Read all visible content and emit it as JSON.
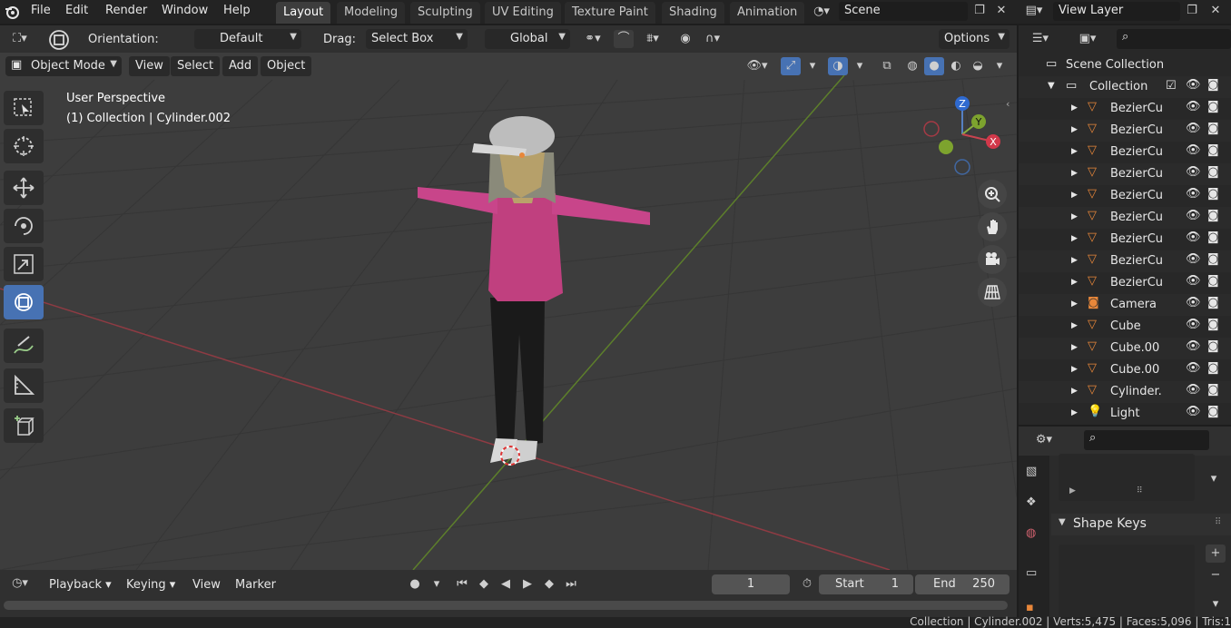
{
  "menu": {
    "items": [
      "File",
      "Edit",
      "Render",
      "Window",
      "Help"
    ]
  },
  "workspaces": {
    "tabs": [
      "Layout",
      "Modeling",
      "Sculpting",
      "UV Editing",
      "Texture Paint",
      "Shading",
      "Animation"
    ],
    "active": "Layout"
  },
  "scene": {
    "name": "Scene"
  },
  "view_layer": {
    "name": "View Layer"
  },
  "tool_header": {
    "orientation_label": "Orientation:",
    "orientation_value": "Default",
    "drag_label": "Drag:",
    "drag_value": "Select Box",
    "transform_orientation": "Global",
    "options_label": "Options"
  },
  "viewport_header": {
    "mode": "Object Mode",
    "menus": [
      "View",
      "Select",
      "Add",
      "Object"
    ]
  },
  "viewport": {
    "perspective_label": "User Perspective",
    "context_label": "(1) Collection | Cylinder.002",
    "gizmo_axes": {
      "z": "Z",
      "y": "Y",
      "x": "X"
    }
  },
  "timeline": {
    "menus": [
      "Playback",
      "Keying",
      "View",
      "Marker"
    ],
    "current_frame": "1",
    "start_label": "Start",
    "start_value": "1",
    "end_label": "End",
    "end_value": "250"
  },
  "outliner": {
    "root": "Scene Collection",
    "collection": "Collection",
    "items": [
      {
        "name": "BezierCu",
        "type": "curve"
      },
      {
        "name": "BezierCu",
        "type": "curve"
      },
      {
        "name": "BezierCu",
        "type": "curve"
      },
      {
        "name": "BezierCu",
        "type": "curve"
      },
      {
        "name": "BezierCu",
        "type": "curve"
      },
      {
        "name": "BezierCu",
        "type": "curve"
      },
      {
        "name": "BezierCu",
        "type": "curve"
      },
      {
        "name": "BezierCu",
        "type": "curve"
      },
      {
        "name": "BezierCu",
        "type": "curve"
      },
      {
        "name": "Camera",
        "type": "camera"
      },
      {
        "name": "Cube",
        "type": "mesh"
      },
      {
        "name": "Cube.00",
        "type": "mesh"
      },
      {
        "name": "Cube.00",
        "type": "mesh"
      },
      {
        "name": "Cylinder.",
        "type": "mesh"
      },
      {
        "name": "Light",
        "type": "light"
      }
    ]
  },
  "properties": {
    "section_title": "Shape Keys"
  },
  "statusbar": {
    "text": "Collection | Cylinder.002 | Verts:5,475 | Faces:5,096 | Tris:1"
  },
  "colors": {
    "accent": "#4772b3",
    "x_axis": "#b5353f",
    "y_axis": "#6d9a2a",
    "object_orange": "#e8873a"
  }
}
